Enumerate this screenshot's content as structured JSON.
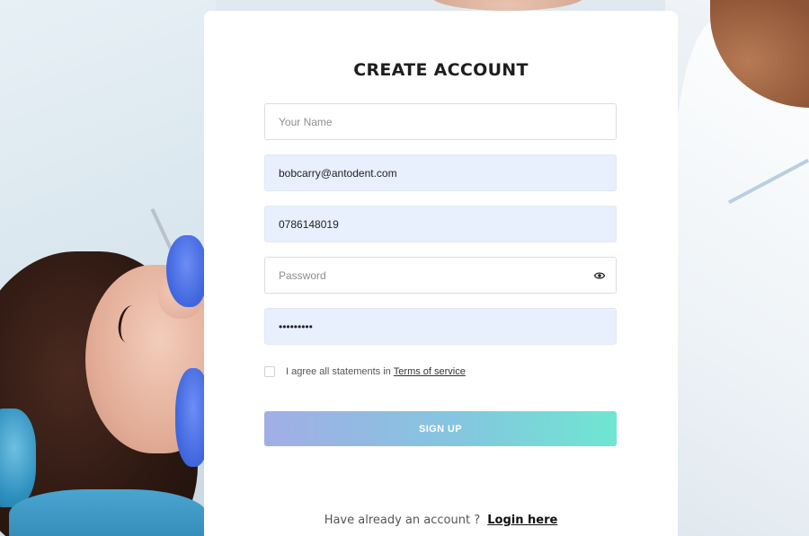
{
  "form": {
    "title": "CREATE ACCOUNT",
    "fields": {
      "name": {
        "value": "",
        "placeholder": "Your Name"
      },
      "email": {
        "value": "bobcarry@antodent.com",
        "placeholder": ""
      },
      "phone": {
        "value": "0786148019",
        "placeholder": ""
      },
      "password": {
        "value": "",
        "placeholder": "Password"
      },
      "repeat_password": {
        "value": "•••••••••",
        "placeholder": ""
      }
    },
    "agree": {
      "checked": false,
      "text": "I agree all statements in",
      "link_label": "Terms of service"
    },
    "submit_label": "SIGN UP",
    "login": {
      "prompt": "Have already an account ?",
      "link_label": "Login here"
    }
  },
  "colors": {
    "button_gradient_start": "#a1aee6",
    "button_gradient_end": "#6fe6d2",
    "autofill_bg": "#e8f0fe"
  },
  "icons": {
    "password_toggle": "eye-icon"
  }
}
